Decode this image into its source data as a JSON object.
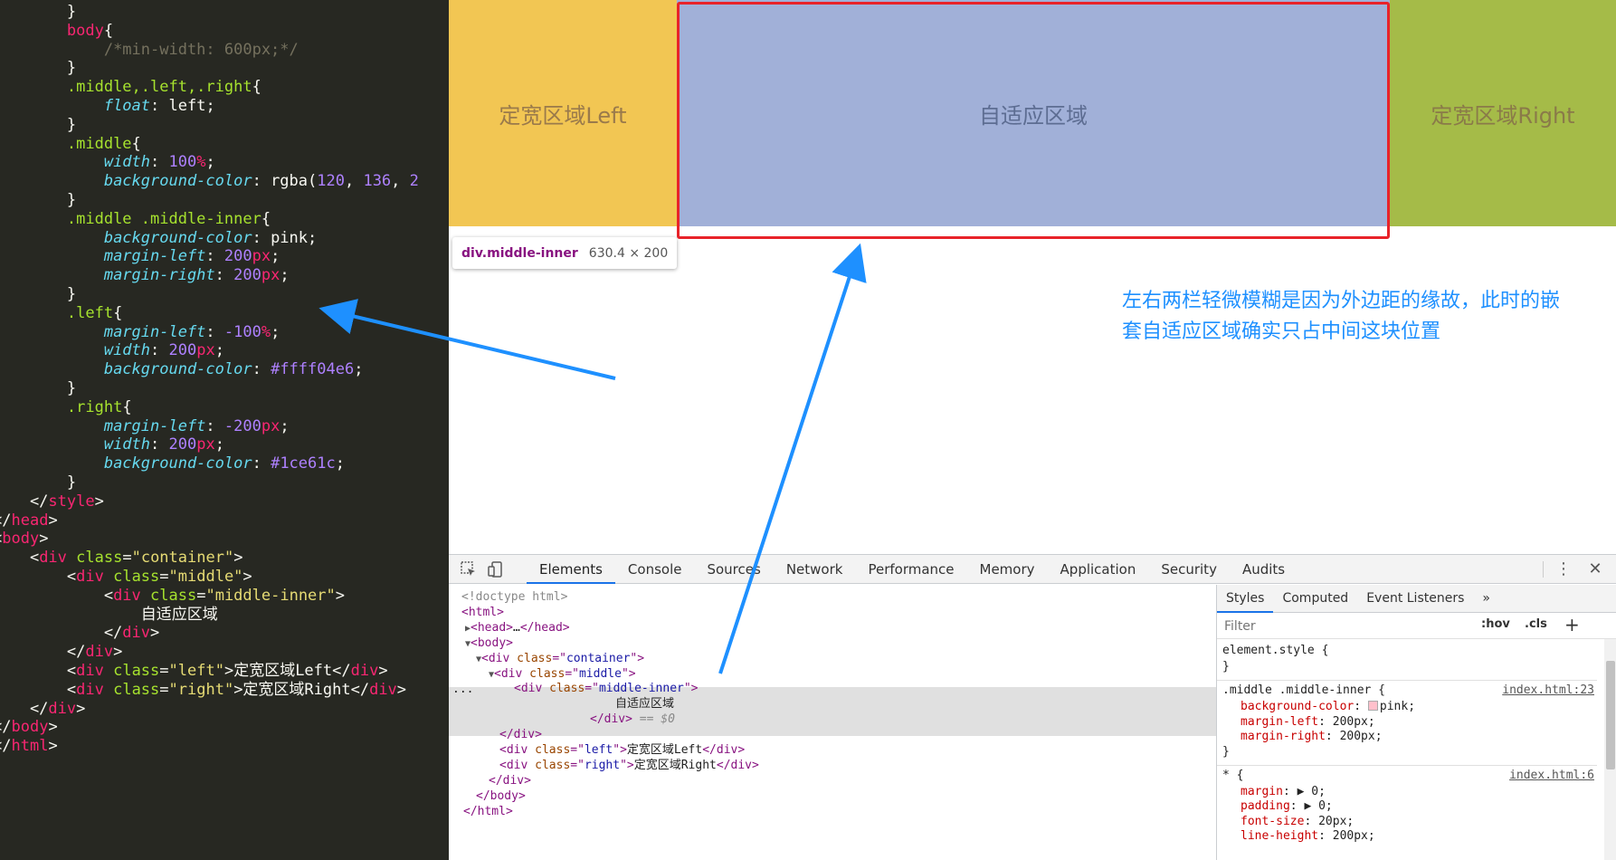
{
  "editor": {
    "lines": [
      [
        {
          "t": "        }",
          "c": "c-text"
        }
      ],
      [
        {
          "t": "        ",
          "c": "c-text"
        },
        {
          "t": "body",
          "c": "c-tag"
        },
        {
          "t": "{",
          "c": "c-text"
        }
      ],
      [
        {
          "t": "            ",
          "c": "c-text"
        },
        {
          "t": "/*min-width: 600px;*/",
          "c": "c-comment"
        }
      ],
      [
        {
          "t": "        }",
          "c": "c-text"
        }
      ],
      [
        {
          "t": "        ",
          "c": "c-text"
        },
        {
          "t": ".middle,.left,.right",
          "c": "c-sel"
        },
        {
          "t": "{",
          "c": "c-text"
        }
      ],
      [
        {
          "t": "            ",
          "c": "c-text"
        },
        {
          "t": "float",
          "c": "c-prop"
        },
        {
          "t": ": ",
          "c": "c-text"
        },
        {
          "t": "left",
          "c": "c-text"
        },
        {
          "t": ";",
          "c": "c-text"
        }
      ],
      [
        {
          "t": "        }",
          "c": "c-text"
        }
      ],
      [
        {
          "t": "        ",
          "c": "c-text"
        },
        {
          "t": ".middle",
          "c": "c-sel"
        },
        {
          "t": "{",
          "c": "c-text"
        }
      ],
      [
        {
          "t": "            ",
          "c": "c-text"
        },
        {
          "t": "width",
          "c": "c-prop"
        },
        {
          "t": ": ",
          "c": "c-text"
        },
        {
          "t": "100",
          "c": "c-num"
        },
        {
          "t": "%",
          "c": "c-unit"
        },
        {
          "t": ";",
          "c": "c-text"
        }
      ],
      [
        {
          "t": "            ",
          "c": "c-text"
        },
        {
          "t": "background-color",
          "c": "c-prop"
        },
        {
          "t": ": rgba(",
          "c": "c-text"
        },
        {
          "t": "120",
          "c": "c-num"
        },
        {
          "t": ", ",
          "c": "c-text"
        },
        {
          "t": "136",
          "c": "c-num"
        },
        {
          "t": ", ",
          "c": "c-text"
        },
        {
          "t": "2",
          "c": "c-num"
        }
      ],
      [
        {
          "t": "        }",
          "c": "c-text"
        }
      ],
      [
        {
          "t": "        ",
          "c": "c-text"
        },
        {
          "t": ".middle .middle-inner",
          "c": "c-sel"
        },
        {
          "t": "{",
          "c": "c-text"
        }
      ],
      [
        {
          "t": "            ",
          "c": "c-text"
        },
        {
          "t": "background-color",
          "c": "c-prop"
        },
        {
          "t": ": pink;",
          "c": "c-text"
        }
      ],
      [
        {
          "t": "            ",
          "c": "c-text"
        },
        {
          "t": "margin-left",
          "c": "c-prop"
        },
        {
          "t": ": ",
          "c": "c-text"
        },
        {
          "t": "200",
          "c": "c-num"
        },
        {
          "t": "px",
          "c": "c-unit"
        },
        {
          "t": ";",
          "c": "c-text"
        }
      ],
      [
        {
          "t": "            ",
          "c": "c-text"
        },
        {
          "t": "margin-right",
          "c": "c-prop"
        },
        {
          "t": ": ",
          "c": "c-text"
        },
        {
          "t": "200",
          "c": "c-num"
        },
        {
          "t": "px",
          "c": "c-unit"
        },
        {
          "t": ";",
          "c": "c-text"
        }
      ],
      [
        {
          "t": "        }",
          "c": "c-text"
        }
      ],
      [
        {
          "t": "        ",
          "c": "c-text"
        },
        {
          "t": ".left",
          "c": "c-sel"
        },
        {
          "t": "{",
          "c": "c-text"
        }
      ],
      [
        {
          "t": "            ",
          "c": "c-text"
        },
        {
          "t": "margin-left",
          "c": "c-prop"
        },
        {
          "t": ": ",
          "c": "c-text"
        },
        {
          "t": "-100",
          "c": "c-num"
        },
        {
          "t": "%",
          "c": "c-unit"
        },
        {
          "t": ";",
          "c": "c-text"
        }
      ],
      [
        {
          "t": "            ",
          "c": "c-text"
        },
        {
          "t": "width",
          "c": "c-prop"
        },
        {
          "t": ": ",
          "c": "c-text"
        },
        {
          "t": "200",
          "c": "c-num"
        },
        {
          "t": "px",
          "c": "c-unit"
        },
        {
          "t": ";",
          "c": "c-text"
        }
      ],
      [
        {
          "t": "            ",
          "c": "c-text"
        },
        {
          "t": "background-color",
          "c": "c-prop"
        },
        {
          "t": ": ",
          "c": "c-text"
        },
        {
          "t": "#ffff04e6",
          "c": "c-num"
        },
        {
          "t": ";",
          "c": "c-text"
        }
      ],
      [
        {
          "t": "        }",
          "c": "c-text"
        }
      ],
      [
        {
          "t": "        ",
          "c": "c-text"
        },
        {
          "t": ".right",
          "c": "c-sel"
        },
        {
          "t": "{",
          "c": "c-text"
        }
      ],
      [
        {
          "t": "            ",
          "c": "c-text"
        },
        {
          "t": "margin-left",
          "c": "c-prop"
        },
        {
          "t": ": ",
          "c": "c-text"
        },
        {
          "t": "-200",
          "c": "c-num"
        },
        {
          "t": "px",
          "c": "c-unit"
        },
        {
          "t": ";",
          "c": "c-text"
        }
      ],
      [
        {
          "t": "            ",
          "c": "c-text"
        },
        {
          "t": "width",
          "c": "c-prop"
        },
        {
          "t": ": ",
          "c": "c-text"
        },
        {
          "t": "200",
          "c": "c-num"
        },
        {
          "t": "px",
          "c": "c-unit"
        },
        {
          "t": ";",
          "c": "c-text"
        }
      ],
      [
        {
          "t": "            ",
          "c": "c-text"
        },
        {
          "t": "background-color",
          "c": "c-prop"
        },
        {
          "t": ": ",
          "c": "c-text"
        },
        {
          "t": "#1ce61c",
          "c": "c-num"
        },
        {
          "t": ";",
          "c": "c-text"
        }
      ],
      [
        {
          "t": "        }",
          "c": "c-text"
        }
      ],
      [
        {
          "t": "    </",
          "c": "c-text"
        },
        {
          "t": "style",
          "c": "c-tag"
        },
        {
          "t": ">",
          "c": "c-text"
        }
      ],
      [
        {
          "t": "</",
          "c": "c-text"
        },
        {
          "t": "head",
          "c": "c-tag"
        },
        {
          "t": ">",
          "c": "c-text"
        }
      ],
      [
        {
          "t": "<",
          "c": "c-text"
        },
        {
          "t": "body",
          "c": "c-tag"
        },
        {
          "t": ">",
          "c": "c-text"
        }
      ],
      [
        {
          "t": "    <",
          "c": "c-text"
        },
        {
          "t": "div",
          "c": "c-tag"
        },
        {
          "t": " ",
          "c": "c-text"
        },
        {
          "t": "class",
          "c": "c-attr"
        },
        {
          "t": "=",
          "c": "c-text"
        },
        {
          "t": "\"container\"",
          "c": "c-str"
        },
        {
          "t": ">",
          "c": "c-text"
        }
      ],
      [
        {
          "t": "        <",
          "c": "c-text"
        },
        {
          "t": "div",
          "c": "c-tag"
        },
        {
          "t": " ",
          "c": "c-text"
        },
        {
          "t": "class",
          "c": "c-attr"
        },
        {
          "t": "=",
          "c": "c-text"
        },
        {
          "t": "\"middle\"",
          "c": "c-str"
        },
        {
          "t": ">",
          "c": "c-text"
        }
      ],
      [
        {
          "t": "            <",
          "c": "c-text"
        },
        {
          "t": "div",
          "c": "c-tag"
        },
        {
          "t": " ",
          "c": "c-text"
        },
        {
          "t": "class",
          "c": "c-attr"
        },
        {
          "t": "=",
          "c": "c-text"
        },
        {
          "t": "\"middle-inner\"",
          "c": "c-str"
        },
        {
          "t": ">",
          "c": "c-text"
        }
      ],
      [
        {
          "t": "                自适应区域",
          "c": "c-text"
        }
      ],
      [
        {
          "t": "            </",
          "c": "c-text"
        },
        {
          "t": "div",
          "c": "c-tag"
        },
        {
          "t": ">",
          "c": "c-text"
        }
      ],
      [
        {
          "t": "        </",
          "c": "c-text"
        },
        {
          "t": "div",
          "c": "c-tag"
        },
        {
          "t": ">",
          "c": "c-text"
        }
      ],
      [
        {
          "t": "        <",
          "c": "c-text"
        },
        {
          "t": "div",
          "c": "c-tag"
        },
        {
          "t": " ",
          "c": "c-text"
        },
        {
          "t": "class",
          "c": "c-attr"
        },
        {
          "t": "=",
          "c": "c-text"
        },
        {
          "t": "\"left\"",
          "c": "c-str"
        },
        {
          "t": ">定宽区域Left</",
          "c": "c-text"
        },
        {
          "t": "div",
          "c": "c-tag"
        },
        {
          "t": ">",
          "c": "c-text"
        }
      ],
      [
        {
          "t": "        <",
          "c": "c-text"
        },
        {
          "t": "div",
          "c": "c-tag"
        },
        {
          "t": " ",
          "c": "c-text"
        },
        {
          "t": "class",
          "c": "c-attr"
        },
        {
          "t": "=",
          "c": "c-text"
        },
        {
          "t": "\"right\"",
          "c": "c-str"
        },
        {
          "t": ">定宽区域Right</",
          "c": "c-text"
        },
        {
          "t": "div",
          "c": "c-tag"
        },
        {
          "t": ">",
          "c": "c-text"
        }
      ],
      [
        {
          "t": "    </",
          "c": "c-text"
        },
        {
          "t": "div",
          "c": "c-tag"
        },
        {
          "t": ">",
          "c": "c-text"
        }
      ],
      [
        {
          "t": "</",
          "c": "c-text"
        },
        {
          "t": "body",
          "c": "c-tag"
        },
        {
          "t": ">",
          "c": "c-text"
        }
      ],
      [
        {
          "t": "</",
          "c": "c-text"
        },
        {
          "t": "html",
          "c": "c-tag"
        },
        {
          "t": ">",
          "c": "c-text"
        }
      ]
    ]
  },
  "page": {
    "left_label": "定宽区域Left",
    "inner_label": "自适应区域",
    "right_label": "定宽区域Right",
    "colors": {
      "left": "#f2c653",
      "inner": "#a1b0d8",
      "right": "#a5bb48",
      "highlight": "#e8232a"
    }
  },
  "tooltip": {
    "name": "div.middle-inner",
    "size": "630.4 × 200"
  },
  "annotation": {
    "text": "左右两栏轻微模糊是因为外边距的缘故，此时的嵌套自适应区域确实只占中间这块位置",
    "color": "#1e90ff"
  },
  "devtools": {
    "tabs": [
      "Elements",
      "Console",
      "Sources",
      "Network",
      "Performance",
      "Memory",
      "Application",
      "Security",
      "Audits"
    ],
    "active_tab": "Elements",
    "more_icon": "⋮",
    "close_icon": "✕"
  },
  "dom": {
    "selected_marker": "...",
    "lines": [
      [
        {
          "t": "<!doctype html>",
          "c": "d-doc"
        }
      ],
      [
        {
          "t": "<html>",
          "c": "d-tag"
        }
      ],
      [
        {
          "t": "▶",
          "c": "d-tri"
        },
        {
          "t": "<head>",
          "c": "d-tag"
        },
        {
          "t": "…",
          "c": "d-text"
        },
        {
          "t": "</head>",
          "c": "d-tag"
        }
      ],
      [
        {
          "t": "▼",
          "c": "d-tri"
        },
        {
          "t": "<body>",
          "c": "d-tag"
        }
      ],
      [
        {
          "t": "▼",
          "c": "d-tri"
        },
        {
          "t": "<div ",
          "c": "d-tag"
        },
        {
          "t": "class",
          "c": "d-attr"
        },
        {
          "t": "=\"",
          "c": "d-tag"
        },
        {
          "t": "container",
          "c": "d-val"
        },
        {
          "t": "\">",
          "c": "d-tag"
        }
      ],
      [
        {
          "t": "▼",
          "c": "d-tri"
        },
        {
          "t": "<div ",
          "c": "d-tag"
        },
        {
          "t": "class",
          "c": "d-attr"
        },
        {
          "t": "=\"",
          "c": "d-tag"
        },
        {
          "t": "middle",
          "c": "d-val"
        },
        {
          "t": "\">",
          "c": "d-tag"
        }
      ],
      [
        {
          "t": "<div ",
          "c": "d-tag"
        },
        {
          "t": "class",
          "c": "d-attr"
        },
        {
          "t": "=\"",
          "c": "d-tag"
        },
        {
          "t": "middle-inner",
          "c": "d-val"
        },
        {
          "t": "\">",
          "c": "d-tag"
        }
      ],
      [
        {
          "t": "自适应区域",
          "c": "d-text"
        }
      ],
      [
        {
          "t": "</div>",
          "c": "d-tag"
        },
        {
          "t": " == $0",
          "c": "d-eq"
        }
      ],
      [
        {
          "t": "</div>",
          "c": "d-tag"
        }
      ],
      [
        {
          "t": "<div ",
          "c": "d-tag"
        },
        {
          "t": "class",
          "c": "d-attr"
        },
        {
          "t": "=\"",
          "c": "d-tag"
        },
        {
          "t": "left",
          "c": "d-val"
        },
        {
          "t": "\">",
          "c": "d-tag"
        },
        {
          "t": "定宽区域Left",
          "c": "d-text"
        },
        {
          "t": "</div>",
          "c": "d-tag"
        }
      ],
      [
        {
          "t": "<div ",
          "c": "d-tag"
        },
        {
          "t": "class",
          "c": "d-attr"
        },
        {
          "t": "=\"",
          "c": "d-tag"
        },
        {
          "t": "right",
          "c": "d-val"
        },
        {
          "t": "\">",
          "c": "d-tag"
        },
        {
          "t": "定宽区域Right",
          "c": "d-text"
        },
        {
          "t": "</div>",
          "c": "d-tag"
        }
      ],
      [
        {
          "t": "</div>",
          "c": "d-tag"
        }
      ],
      [
        {
          "t": "</body>",
          "c": "d-tag"
        }
      ],
      [
        {
          "t": "</html>",
          "c": "d-tag"
        }
      ]
    ]
  },
  "styles": {
    "tabs": [
      "Styles",
      "Computed",
      "Event Listeners",
      "»"
    ],
    "active_tab": "Styles",
    "filter_placeholder": "Filter",
    "hov": ":hov",
    "cls": ".cls",
    "plus": "+",
    "rules": [
      {
        "selector": "element.style {",
        "props": [],
        "close": "}",
        "link": ""
      },
      {
        "selector": ".middle .middle-inner {",
        "link": "index.html:23",
        "props": [
          {
            "k": "background-color",
            "v": "pink;",
            "swatch": true
          },
          {
            "k": "margin-left",
            "v": "200px;"
          },
          {
            "k": "margin-right",
            "v": "200px;"
          }
        ],
        "close": "}"
      },
      {
        "selector": "* {",
        "link": "index.html:6",
        "props": [
          {
            "k": "margin",
            "v": "▶ 0;"
          },
          {
            "k": "padding",
            "v": "▶ 0;"
          },
          {
            "k": "font-size",
            "v": "20px;"
          },
          {
            "k": "line-height",
            "v": "200px;"
          }
        ],
        "close": ""
      }
    ]
  }
}
